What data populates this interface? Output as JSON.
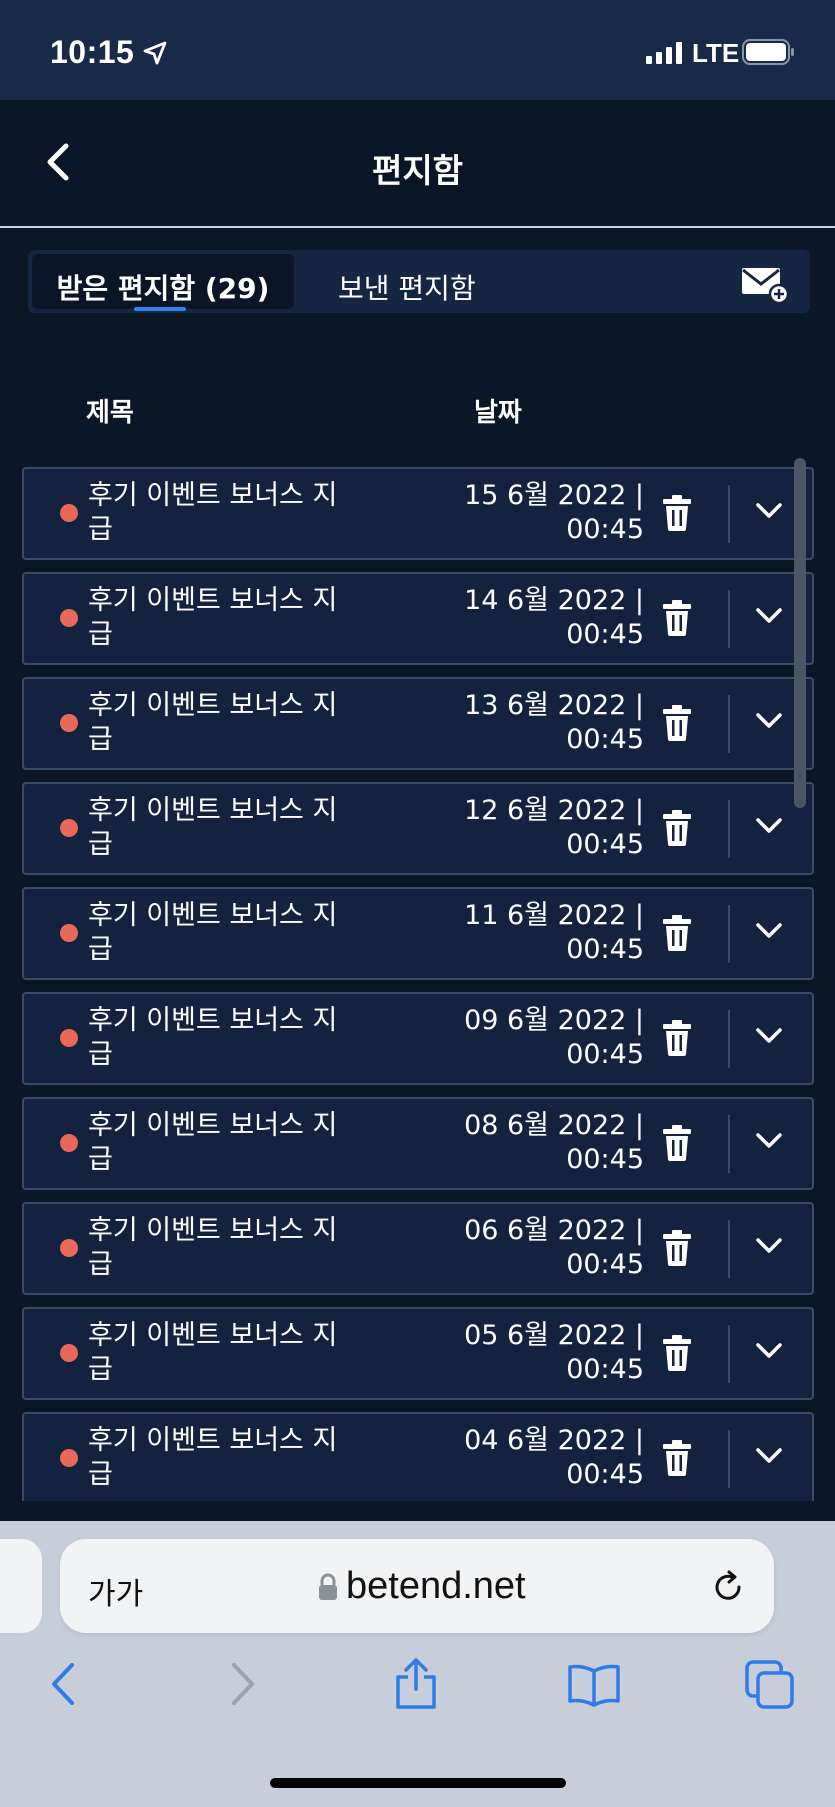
{
  "status_bar": {
    "time": "10:15",
    "network": "LTE"
  },
  "header": {
    "title": "편지함"
  },
  "tabs": {
    "inbox_label": "받은 편지함 (29)",
    "sent_label": "보낸 편지함"
  },
  "columns": {
    "subject": "제목",
    "date": "날짜"
  },
  "messages": [
    {
      "subject": "후기 이벤트 보너스 지급",
      "date_line1": "15 6월 2022 |",
      "date_line2": "00:45"
    },
    {
      "subject": "후기 이벤트 보너스 지급",
      "date_line1": "14 6월 2022 |",
      "date_line2": "00:45"
    },
    {
      "subject": "후기 이벤트 보너스 지급",
      "date_line1": "13 6월 2022 |",
      "date_line2": "00:45"
    },
    {
      "subject": "후기 이벤트 보너스 지급",
      "date_line1": "12 6월 2022 |",
      "date_line2": "00:45"
    },
    {
      "subject": "후기 이벤트 보너스 지급",
      "date_line1": "11 6월 2022 |",
      "date_line2": "00:45"
    },
    {
      "subject": "후기 이벤트 보너스 지급",
      "date_line1": "09 6월 2022 |",
      "date_line2": "00:45"
    },
    {
      "subject": "후기 이벤트 보너스 지급",
      "date_line1": "08 6월 2022 |",
      "date_line2": "00:45"
    },
    {
      "subject": "후기 이벤트 보너스 지급",
      "date_line1": "06 6월 2022 |",
      "date_line2": "00:45"
    },
    {
      "subject": "후기 이벤트 보너스 지급",
      "date_line1": "05 6월 2022 |",
      "date_line2": "00:45"
    },
    {
      "subject": "후기 이벤트 보너스 지급",
      "date_line1": "04 6월 2022 |",
      "date_line2": "00:45"
    }
  ],
  "browser": {
    "text_size_label": "가가",
    "url": "betend.net"
  },
  "colors": {
    "background": "#0b1626",
    "row_background": "#13233f",
    "unread_dot": "#e8685a",
    "accent": "#2f86e8",
    "browser_icon": "#2f7bea"
  }
}
